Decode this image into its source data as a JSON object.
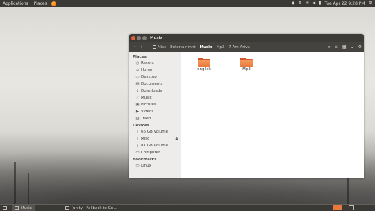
{
  "top_panel": {
    "applications": "Applications",
    "places": "Places",
    "browser_icon": "firefox-icon",
    "clock": "Tue Apr 22  9:28 PM",
    "tray_icons": [
      "dropbox-icon",
      "network-icon",
      "email-icon",
      "volume-icon",
      "battery-icon",
      "user-icon"
    ]
  },
  "window": {
    "title": "Musix",
    "breadcrumbs": [
      "Misc",
      "Entertainmnt",
      "Musix",
      "Mp3",
      "7 Am Arivu"
    ],
    "active_crumb_index": 2
  },
  "sidebar": {
    "sections": [
      {
        "heading": "Places",
        "items": [
          {
            "label": "Recent",
            "icon": "clock-icon"
          },
          {
            "label": "Home",
            "icon": "home-icon"
          },
          {
            "label": "Desktop",
            "icon": "desktop-icon"
          },
          {
            "label": "Documents",
            "icon": "documents-icon"
          },
          {
            "label": "Downloads",
            "icon": "download-icon"
          },
          {
            "label": "Music",
            "icon": "music-icon"
          },
          {
            "label": "Pictures",
            "icon": "pictures-icon"
          },
          {
            "label": "Videos",
            "icon": "videos-icon"
          },
          {
            "label": "Trash",
            "icon": "trash-icon"
          }
        ]
      },
      {
        "heading": "Devices",
        "items": [
          {
            "label": "66 GB Volume",
            "icon": "drive-icon"
          },
          {
            "label": "Misc",
            "icon": "drive-icon",
            "eject": true
          },
          {
            "label": "81 GB Volume",
            "icon": "drive-icon"
          },
          {
            "label": "Computer",
            "icon": "computer-icon"
          }
        ]
      },
      {
        "heading": "Bookmarks",
        "items": [
          {
            "label": "Linux",
            "icon": "folder-icon"
          }
        ]
      }
    ]
  },
  "content": {
    "folders": [
      {
        "label": "english"
      },
      {
        "label": "Mp3"
      }
    ]
  },
  "bottom_panel": {
    "tasks": [
      {
        "label": "Musix",
        "active": true
      },
      {
        "label": "[unity - Fallback to Gn…",
        "active": false
      }
    ]
  },
  "colors": {
    "accent": "#e0613a",
    "panel": "#3a3935",
    "folder": "#e8793b"
  }
}
